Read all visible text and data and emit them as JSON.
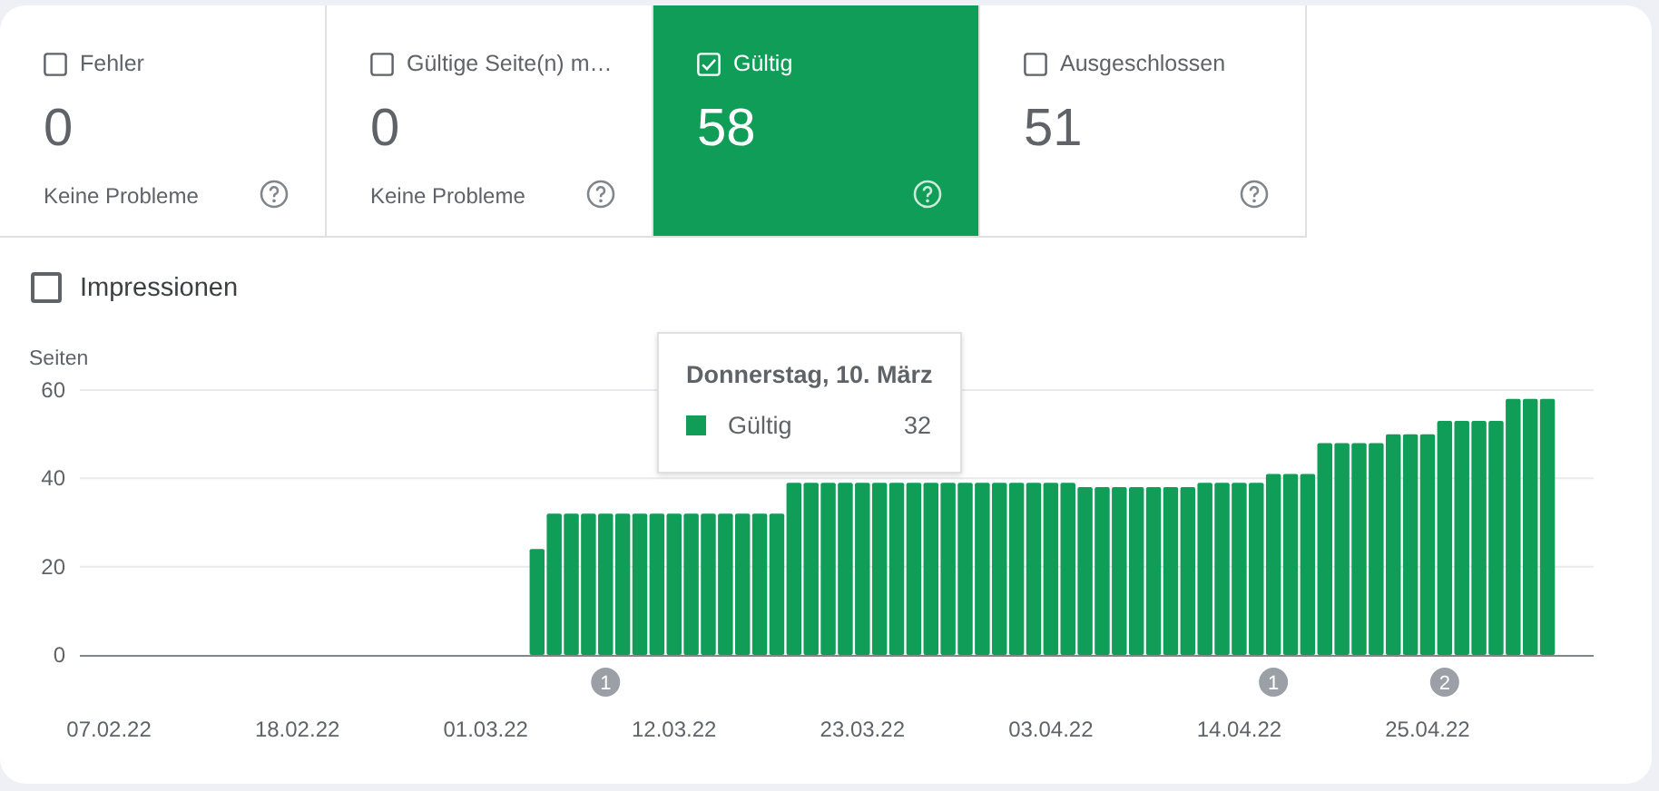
{
  "tabs": [
    {
      "label": "Fehler",
      "value": "0",
      "note": "Keine Probleme",
      "selected": false
    },
    {
      "label": "Gültige Seite(n) m…",
      "value": "0",
      "note": "Keine Probleme",
      "selected": false
    },
    {
      "label": "Gültig",
      "value": "58",
      "selected": true
    },
    {
      "label": "Ausgeschlossen",
      "value": "51",
      "selected": false
    }
  ],
  "impressions": {
    "label": "Impressionen",
    "checked": false
  },
  "chart": {
    "chart_data": {
      "type": "bar",
      "ylabel": "Seiten",
      "categories": [
        "07.02.22",
        null,
        null,
        null,
        null,
        null,
        null,
        null,
        null,
        null,
        null,
        "18.02.22",
        null,
        null,
        null,
        null,
        null,
        null,
        null,
        null,
        null,
        null,
        "01.03.22",
        null,
        null,
        null,
        null,
        null,
        null,
        null,
        null,
        null,
        null,
        "12.03.22",
        null,
        null,
        null,
        null,
        null,
        null,
        null,
        null,
        null,
        null,
        "23.03.22",
        null,
        null,
        null,
        null,
        null,
        null,
        null,
        null,
        null,
        null,
        "03.04.22",
        null,
        null,
        null,
        null,
        null,
        null,
        null,
        null,
        null,
        null,
        "14.04.22",
        null,
        null,
        null,
        null,
        null,
        null,
        null,
        null,
        null,
        null,
        "25.04.22",
        null,
        null,
        null,
        null,
        null,
        null,
        null
      ],
      "series": [
        {
          "name": "Gültig",
          "color": "#0f9d58",
          "values": [
            null,
            null,
            null,
            null,
            null,
            null,
            null,
            null,
            null,
            null,
            null,
            null,
            null,
            null,
            null,
            null,
            null,
            null,
            null,
            null,
            null,
            null,
            null,
            null,
            null,
            24,
            32,
            32,
            32,
            32,
            32,
            32,
            32,
            32,
            32,
            32,
            32,
            32,
            32,
            32,
            39,
            39,
            39,
            39,
            39,
            39,
            39,
            39,
            39,
            39,
            39,
            39,
            39,
            39,
            39,
            39,
            39,
            38,
            38,
            38,
            38,
            38,
            38,
            38,
            39,
            39,
            39,
            39,
            41,
            41,
            41,
            48,
            48,
            48,
            48,
            50,
            50,
            50,
            53,
            53,
            53,
            53,
            58,
            58,
            58
          ]
        }
      ],
      "ylim": [
        0,
        60
      ],
      "yticks": [
        0,
        20,
        40,
        60
      ],
      "annotations": [
        "1",
        "1",
        "2"
      ]
    },
    "tooltip": {
      "title": "Donnerstag, 10. März",
      "value": "32"
    }
  }
}
